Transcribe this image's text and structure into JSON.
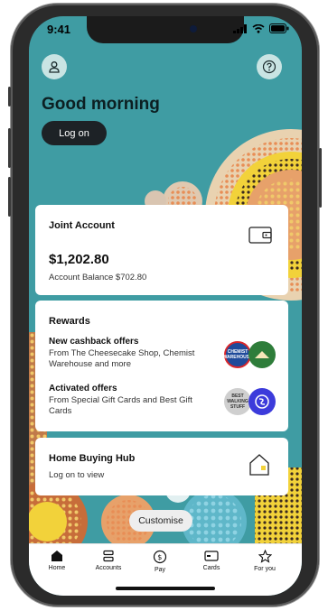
{
  "status_bar": {
    "time": "9:41"
  },
  "header": {
    "greeting": "Good morning",
    "logon_label": "Log on"
  },
  "joint_account": {
    "title": "Joint Account",
    "balance": "$1,202.80",
    "account_balance_text": "Account Balance $702.80"
  },
  "rewards": {
    "title": "Rewards",
    "offers": [
      {
        "title": "New cashback offers",
        "description": "From The Cheesecake Shop, Chemist Warehouse and more"
      },
      {
        "title": "Activated offers",
        "description": "From Special Gift Cards and Best Gift Cards"
      }
    ],
    "logo_texts": [
      "CHEMIST WAREHOUSE",
      "BEST WALKING STUFF"
    ]
  },
  "home_buying": {
    "title": "Home Buying Hub",
    "subtitle": "Log on to view"
  },
  "customise_label": "Customise",
  "tabs": [
    {
      "label": "Home",
      "icon": "home-icon"
    },
    {
      "label": "Accounts",
      "icon": "accounts-icon"
    },
    {
      "label": "Pay",
      "icon": "pay-icon"
    },
    {
      "label": "Cards",
      "icon": "cards-icon"
    },
    {
      "label": "For you",
      "icon": "star-icon"
    }
  ],
  "colors": {
    "background_teal": "#3f9ca3",
    "dark_button": "#1d2226",
    "accent_yellow": "#f2d23a"
  }
}
